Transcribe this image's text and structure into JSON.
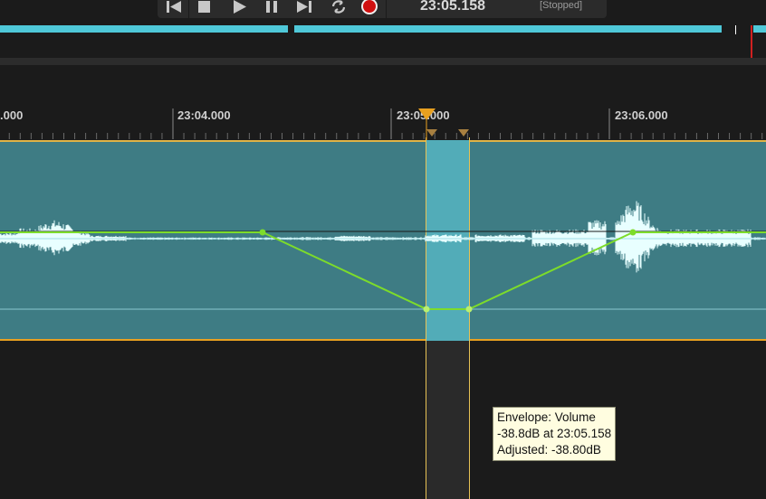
{
  "transport": {
    "timecode": "23:05.158",
    "status": "[Stopped]",
    "buttons": [
      "go-to-start",
      "stop",
      "play",
      "pause",
      "go-to-end",
      "loop",
      "record"
    ],
    "record_color": "#d01010"
  },
  "ruler": {
    "labels": [
      {
        "text": ".000"
      },
      {
        "text": "23:04.000"
      },
      {
        "text": "23:05.000"
      },
      {
        "text": "23:06.000"
      }
    ]
  },
  "envelope": {
    "color": "#7ddc2a"
  },
  "tooltip": {
    "line1": "Envelope: Volume",
    "line2": "-38.8dB at 23:05.158",
    "line3": "Adjusted: -38.80dB"
  },
  "colors": {
    "waveform_bg": "#3e7c84",
    "selection": "#52acb8",
    "waveform": "#e8ffff",
    "accent": "#e8a020"
  }
}
